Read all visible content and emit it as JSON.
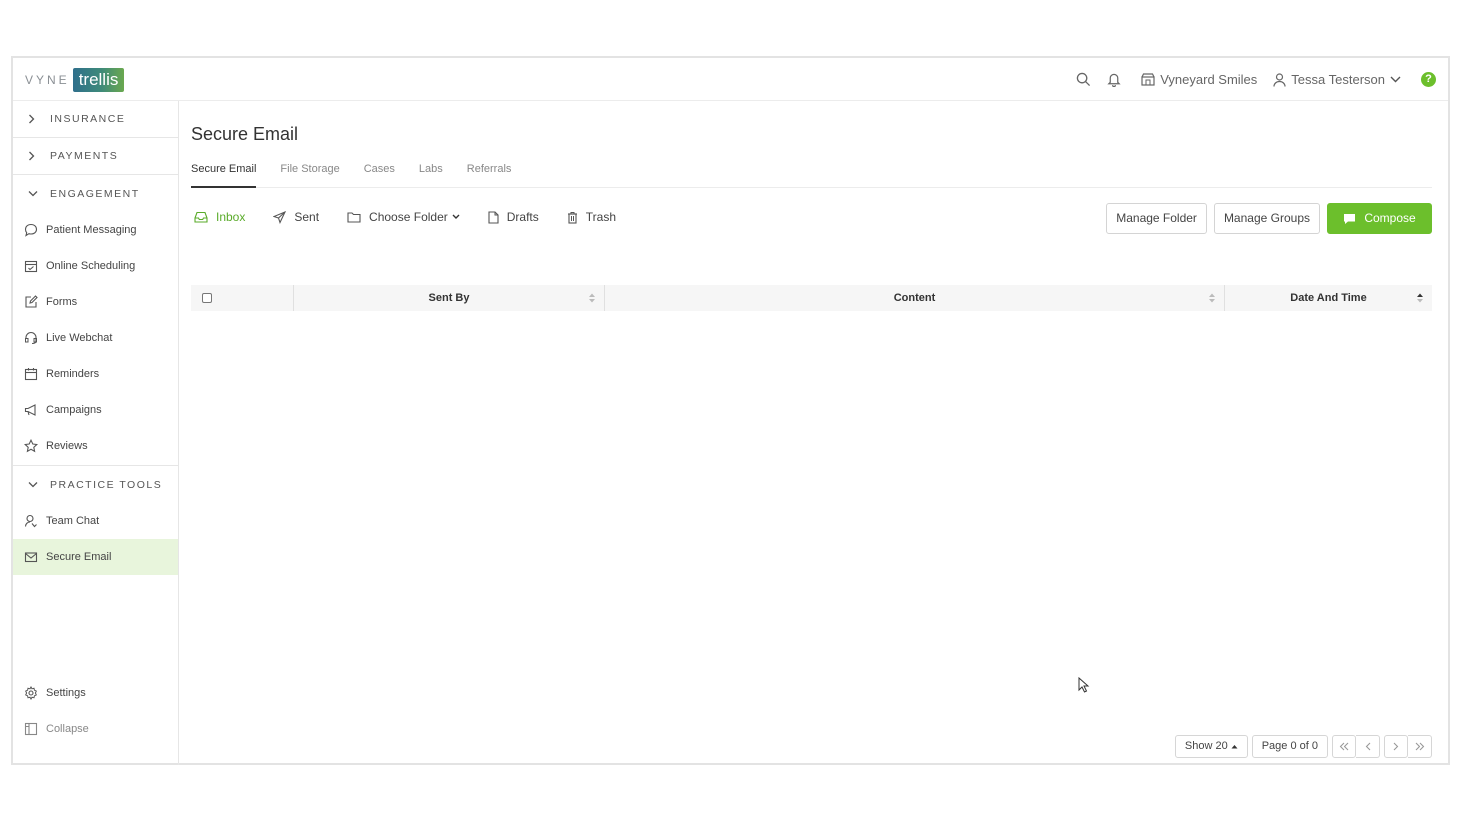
{
  "logo": {
    "left_text": "VYNE",
    "right_text": "trellis"
  },
  "topbar": {
    "practice_name": "Vyneyard Smiles",
    "user_name": "Tessa Testerson",
    "help_label": "?"
  },
  "sidebar": {
    "insurance": "INSURANCE",
    "payments": "PAYMENTS",
    "engagement": "ENGAGEMENT",
    "engagement_items": [
      {
        "label": "Patient Messaging",
        "icon": "chat-bubble-icon"
      },
      {
        "label": "Online Scheduling",
        "icon": "calendar-check-icon"
      },
      {
        "label": "Forms",
        "icon": "edit-form-icon"
      },
      {
        "label": "Live Webchat",
        "icon": "headset-icon"
      },
      {
        "label": "Reminders",
        "icon": "calendar-icon"
      },
      {
        "label": "Campaigns",
        "icon": "megaphone-icon"
      },
      {
        "label": "Reviews",
        "icon": "star-icon"
      }
    ],
    "practice_tools": "PRACTICE TOOLS",
    "tool_items": [
      {
        "label": "Team Chat",
        "icon": "team-chat-icon"
      },
      {
        "label": "Secure Email",
        "icon": "envelope-icon",
        "active": true
      }
    ],
    "settings": "Settings",
    "collapse": "Collapse"
  },
  "main": {
    "title": "Secure Email",
    "tabs": [
      "Secure Email",
      "File Storage",
      "Cases",
      "Labs",
      "Referrals"
    ],
    "active_tab": "Secure Email",
    "folders": {
      "inbox": "Inbox",
      "sent": "Sent",
      "choose_folder": "Choose Folder",
      "drafts": "Drafts",
      "trash": "Trash"
    },
    "buttons": {
      "manage_folder": "Manage Folder",
      "manage_groups": "Manage Groups",
      "compose": "Compose"
    },
    "table": {
      "columns": [
        "Sent By",
        "Content",
        "Date And Time"
      ],
      "rows": []
    },
    "pager": {
      "show": "Show 20",
      "page": "Page 0 of 0"
    }
  },
  "colors": {
    "accent": "#6cbf2c",
    "active_nav_bg": "#e8f5dc"
  }
}
